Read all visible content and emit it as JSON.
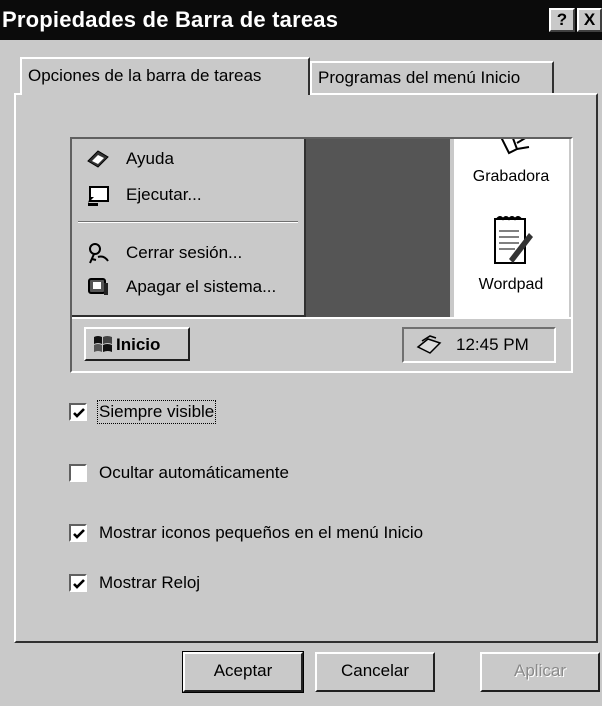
{
  "window": {
    "title": "Propiedades de Barra de tareas",
    "help_glyph": "?",
    "close_glyph": "X"
  },
  "tabs": [
    {
      "label": "Opciones de la barra de tareas",
      "active": true
    },
    {
      "label": "Programas del menú Inicio",
      "active": false
    }
  ],
  "preview": {
    "menu_items": [
      {
        "label": "Ayuda",
        "icon": "help-book-icon"
      },
      {
        "label": "Ejecutar...",
        "icon": "run-icon"
      },
      {
        "label": "Cerrar sesión...",
        "icon": "logoff-keys-icon"
      },
      {
        "label": "Apagar el sistema...",
        "icon": "shutdown-computer-icon"
      }
    ],
    "desktop_icons": [
      {
        "label": "Grabadora",
        "icon": "sound-recorder-icon"
      },
      {
        "label": "Wordpad",
        "icon": "wordpad-icon"
      }
    ],
    "start_button": "Inicio",
    "clock": "12:45 PM"
  },
  "options": [
    {
      "label": "Siempre visible",
      "checked": true
    },
    {
      "label": "Ocultar automáticamente",
      "checked": false
    },
    {
      "label": "Mostrar iconos pequeños en el menú Inicio",
      "checked": true
    },
    {
      "label": "Mostrar Reloj",
      "checked": true
    }
  ],
  "buttons": {
    "ok": "Aceptar",
    "cancel": "Cancelar",
    "apply": "Aplicar"
  },
  "colors": {
    "title_bar": "#0b0b0b",
    "face": "#c9c9c9",
    "desktop_dark": "#555555"
  }
}
